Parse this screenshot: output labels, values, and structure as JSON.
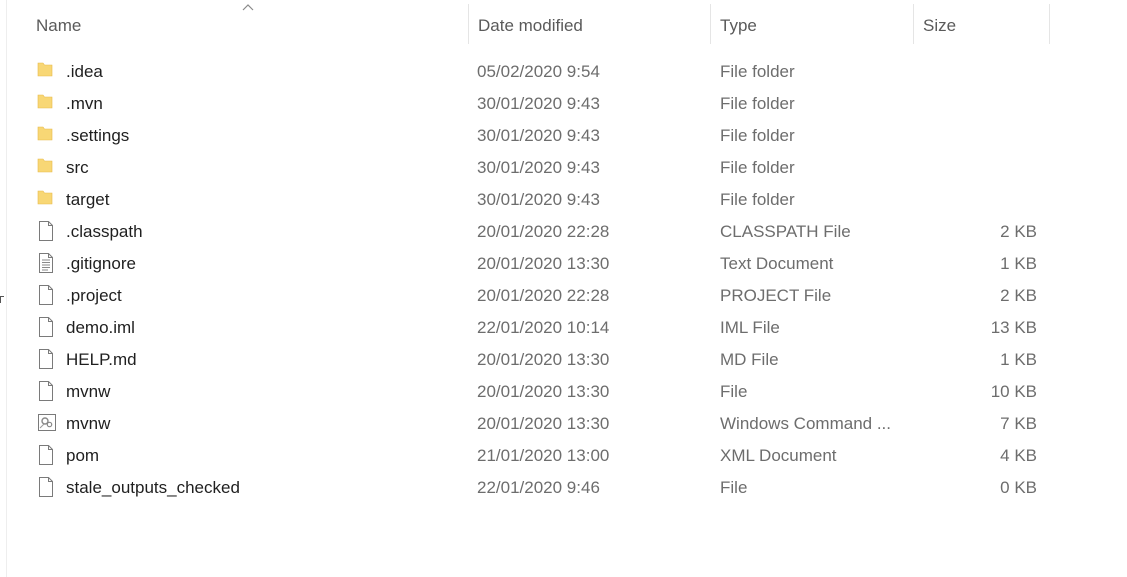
{
  "columns": {
    "name": "Name",
    "date": "Date modified",
    "type": "Type",
    "size": "Size"
  },
  "sort": {
    "column": "name",
    "direction": "ascending"
  },
  "files": [
    {
      "name": ".idea",
      "date": "05/02/2020 9:54",
      "type": "File folder",
      "size": "",
      "icon": "folder"
    },
    {
      "name": ".mvn",
      "date": "30/01/2020 9:43",
      "type": "File folder",
      "size": "",
      "icon": "folder"
    },
    {
      "name": ".settings",
      "date": "30/01/2020 9:43",
      "type": "File folder",
      "size": "",
      "icon": "folder"
    },
    {
      "name": "src",
      "date": "30/01/2020 9:43",
      "type": "File folder",
      "size": "",
      "icon": "folder"
    },
    {
      "name": "target",
      "date": "30/01/2020 9:43",
      "type": "File folder",
      "size": "",
      "icon": "folder"
    },
    {
      "name": ".classpath",
      "date": "20/01/2020 22:28",
      "type": "CLASSPATH File",
      "size": "2 KB",
      "icon": "file"
    },
    {
      "name": ".gitignore",
      "date": "20/01/2020 13:30",
      "type": "Text Document",
      "size": "1 KB",
      "icon": "text-file"
    },
    {
      "name": ".project",
      "date": "20/01/2020 22:28",
      "type": "PROJECT File",
      "size": "2 KB",
      "icon": "file"
    },
    {
      "name": "demo.iml",
      "date": "22/01/2020 10:14",
      "type": "IML File",
      "size": "13 KB",
      "icon": "file"
    },
    {
      "name": "HELP.md",
      "date": "20/01/2020 13:30",
      "type": "MD File",
      "size": "1 KB",
      "icon": "file"
    },
    {
      "name": "mvnw",
      "date": "20/01/2020 13:30",
      "type": "File",
      "size": "10 KB",
      "icon": "file"
    },
    {
      "name": "mvnw",
      "date": "20/01/2020 13:30",
      "type": "Windows Command ...",
      "size": "7 KB",
      "icon": "cmd-file"
    },
    {
      "name": "pom",
      "date": "21/01/2020 13:00",
      "type": "XML Document",
      "size": "4 KB",
      "icon": "file"
    },
    {
      "name": "stale_outputs_checked",
      "date": "22/01/2020 9:46",
      "type": "File",
      "size": "0 KB",
      "icon": "file"
    }
  ],
  "colors": {
    "folder": "#f8d775",
    "folder_dark": "#e8b94a",
    "header_text": "#5a5a5a",
    "secondary_text": "#6d6d6d"
  }
}
